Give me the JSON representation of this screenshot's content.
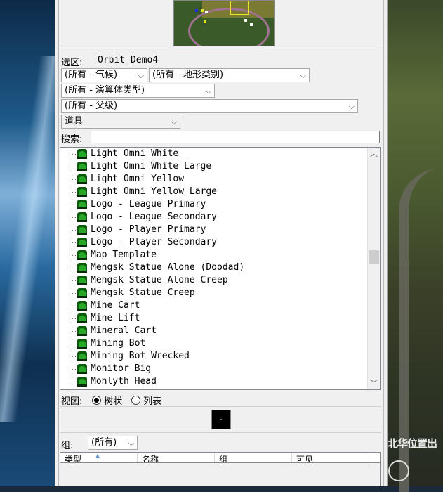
{
  "background": {
    "right_overlay_text": "北华位置出"
  },
  "minimap": {},
  "selection": {
    "label": "选区:",
    "value": "Orbit Demo4"
  },
  "filters": {
    "climate": "(所有 - 气候)",
    "terrain": "(所有 - 地形类别)",
    "actor_type": "(所有 - 演算体类型)",
    "parent": "(所有 - 父级)",
    "category": "道具"
  },
  "search": {
    "label": "搜索:",
    "value": ""
  },
  "tree": {
    "items": [
      "Light Omni White",
      "Light Omni White Large",
      "Light Omni Yellow",
      "Light Omni Yellow Large",
      "Logo - League Primary",
      "Logo - League Secondary",
      "Logo - Player Primary",
      "Logo - Player Secondary",
      "Map Template",
      "Mengsk Statue Alone (Doodad)",
      "Mengsk Statue Alone Creep",
      "Mengsk Statue Creep",
      "Mine Cart",
      "Mine Lift",
      "Mineral Cart",
      "Mining Bot",
      "Mining Bot Wrecked",
      "Monitor Big",
      "Monlyth Head"
    ]
  },
  "view": {
    "label": "视图:",
    "tree_label": "树状",
    "list_label": "列表",
    "selected": "tree"
  },
  "group": {
    "label": "组:",
    "value": "(所有)"
  },
  "list_columns": [
    "类型",
    "名称",
    "组",
    "可见"
  ]
}
